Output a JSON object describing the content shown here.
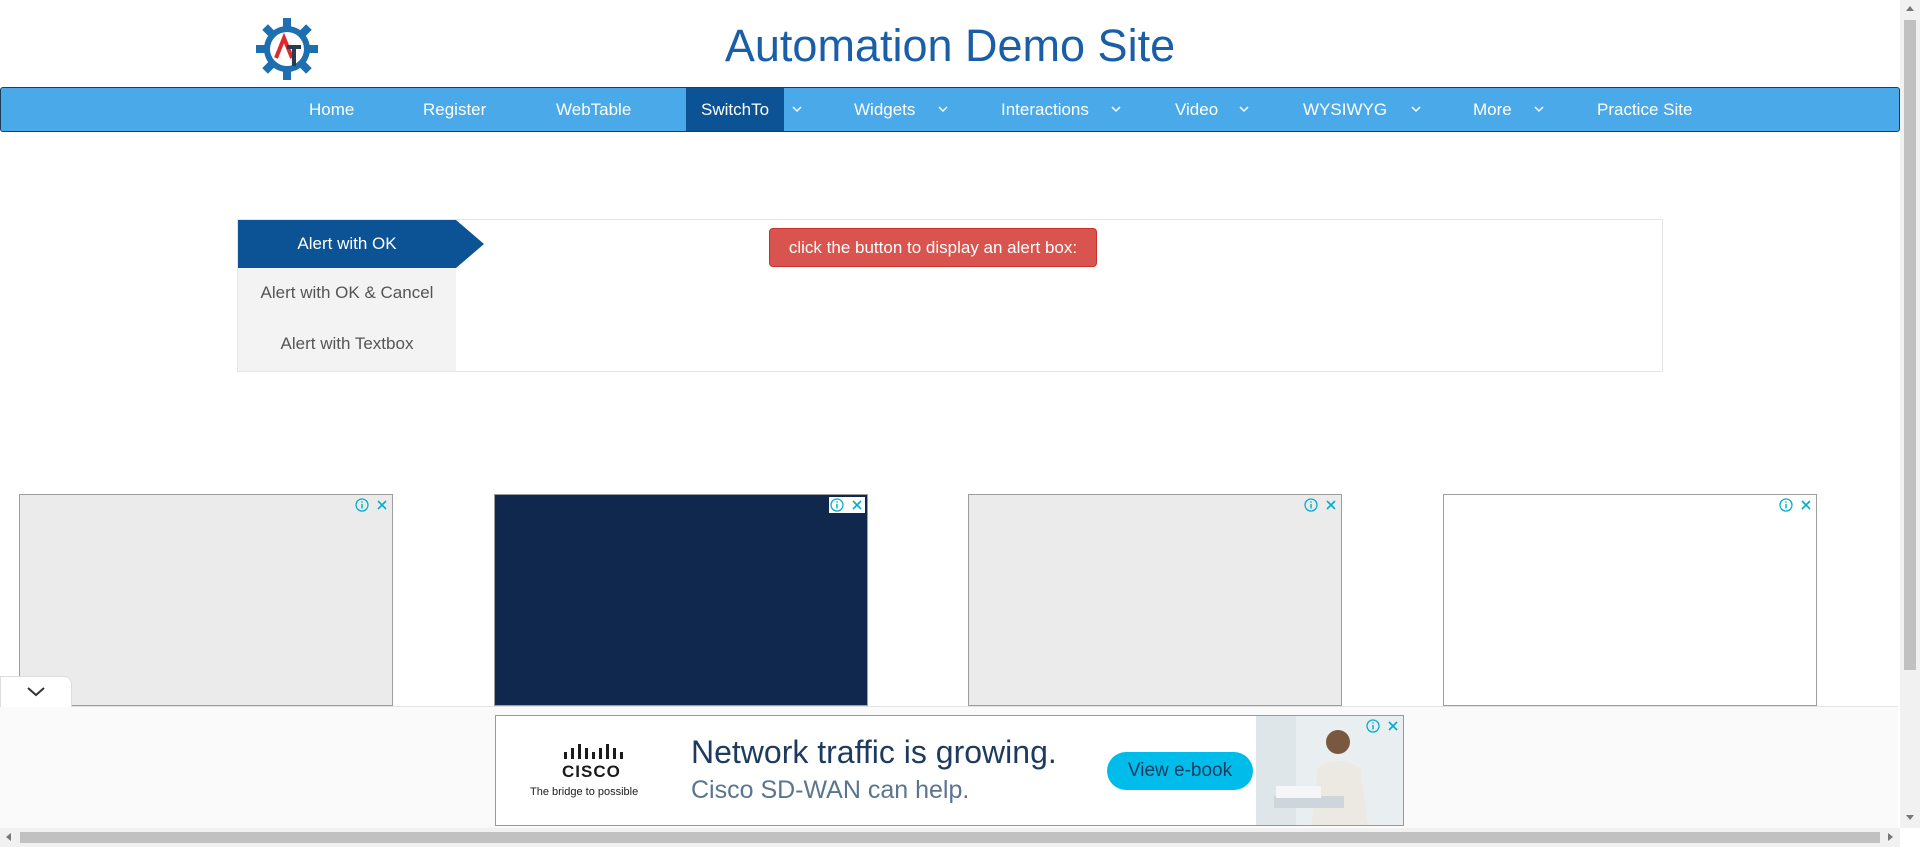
{
  "header": {
    "title": "Automation Demo Site",
    "logo_text": "AT"
  },
  "nav": {
    "items": [
      {
        "label": "Home"
      },
      {
        "label": "Register"
      },
      {
        "label": "WebTable"
      },
      {
        "label": "SwitchTo",
        "active": true,
        "has_dropdown": true
      },
      {
        "label": "Widgets",
        "has_dropdown": true
      },
      {
        "label": "Interactions",
        "has_dropdown": true
      },
      {
        "label": "Video",
        "has_dropdown": true
      },
      {
        "label": "WYSIWYG",
        "has_dropdown": true
      },
      {
        "label": "More",
        "has_dropdown": true
      },
      {
        "label": "Practice Site"
      }
    ]
  },
  "alerts": {
    "tabs": [
      {
        "label": "Alert with OK",
        "active": true
      },
      {
        "label": "Alert with OK & Cancel"
      },
      {
        "label": "Alert with Textbox"
      }
    ],
    "button_label": "click the button to display an alert box:"
  },
  "ads": {
    "slots": [
      {
        "background": "#ebebeb"
      },
      {
        "background": "#10284d"
      },
      {
        "background": "#ebebeb"
      },
      {
        "background": "#ffffff"
      }
    ],
    "banner": {
      "brand": "CISCO",
      "tagline": "The bridge to possible",
      "headline": "Network traffic is growing.",
      "subline": "Cisco SD-WAN can help.",
      "cta": "View e-book",
      "cta_color": "#00bceb"
    }
  },
  "colors": {
    "nav_bg": "#4aa9e8",
    "nav_active": "#0b5394",
    "title": "#1a5ea8",
    "alert_button": "#d9534f"
  }
}
